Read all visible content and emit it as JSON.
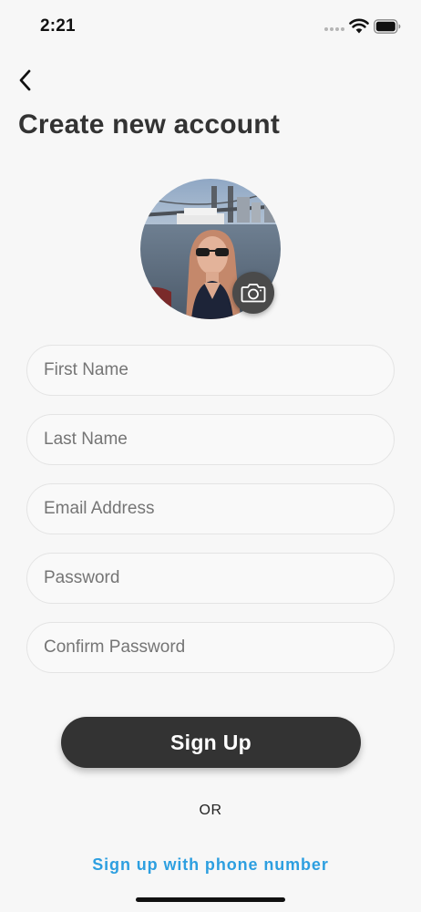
{
  "status_bar": {
    "time": "2:21",
    "icons": [
      "signal-dots-icon",
      "wifi-icon",
      "battery-icon"
    ]
  },
  "header": {
    "back_icon": "chevron-left-icon",
    "title": "Create new account"
  },
  "avatar": {
    "camera_icon": "camera-icon"
  },
  "form": {
    "first_name_placeholder": "First Name",
    "last_name_placeholder": "Last Name",
    "email_placeholder": "Email Address",
    "password_placeholder": "Password",
    "confirm_password_placeholder": "Confirm Password"
  },
  "actions": {
    "signup_label": "Sign Up",
    "or_label": "OR",
    "phone_link_label": "Sign up with phone number"
  },
  "colors": {
    "background": "#f7f7f7",
    "button": "#333333",
    "link": "#2d9fe0"
  }
}
